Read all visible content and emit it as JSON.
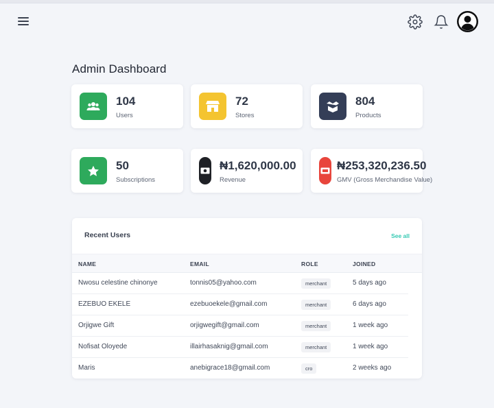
{
  "header": {
    "menu_icon": "hamburger-icon",
    "settings_icon": "gear-icon",
    "notifications_icon": "bell-icon",
    "avatar_icon": "user-avatar-icon"
  },
  "page": {
    "title": "Admin Dashboard"
  },
  "stats": [
    {
      "value": "104",
      "label": "Users",
      "icon": "users-icon",
      "color": "#2eaa5c"
    },
    {
      "value": "72",
      "label": "Stores",
      "icon": "store-icon",
      "color": "#f4c430"
    },
    {
      "value": "804",
      "label": "Products",
      "icon": "box-icon",
      "color": "#343e57"
    },
    {
      "value": "50",
      "label": "Subscriptions",
      "icon": "star-icon",
      "color": "#2eaa5c"
    },
    {
      "value": "₦1,620,000.00",
      "label": "Revenue",
      "icon": "money-icon",
      "color": "#1f2126"
    },
    {
      "value": "₦253,320,236.50",
      "label": "GMV (Gross Merchandise Value)",
      "icon": "gmv-icon",
      "color": "#e8453c"
    }
  ],
  "recent_users": {
    "title": "Recent Users",
    "see_all": "See all",
    "columns": [
      "NAME",
      "EMAIL",
      "ROLE",
      "JOINED"
    ],
    "rows": [
      {
        "name": "Nwosu celestine chinonye",
        "email": "tonnis05@yahoo.com",
        "role": "merchant",
        "joined": "5 days ago"
      },
      {
        "name": "EZEBUO EKELE",
        "email": "ezebuoekele@gmail.com",
        "role": "merchant",
        "joined": "6 days ago"
      },
      {
        "name": "Orjigwe Gift",
        "email": "orjigwegift@gmail.com",
        "role": "merchant",
        "joined": "1 week ago"
      },
      {
        "name": "Nofisat Oloyede",
        "email": "illairhasaknig@gmail.com",
        "role": "merchant",
        "joined": "1 week ago"
      },
      {
        "name": "Maris",
        "email": "anebigrace18@gmail.com",
        "role": "cro",
        "joined": "2 weeks ago"
      }
    ]
  }
}
